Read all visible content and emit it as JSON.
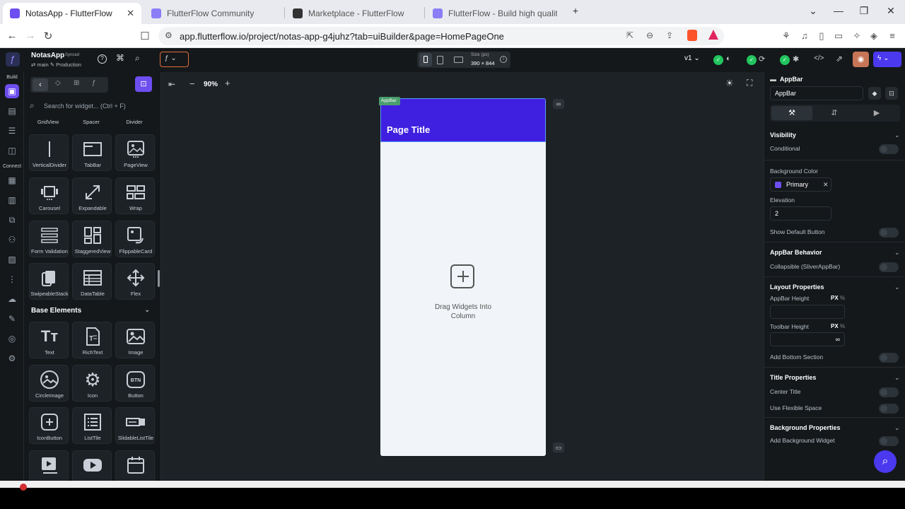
{
  "browser": {
    "tabs": [
      {
        "title": "NotasApp - FlutterFlow",
        "active": true
      },
      {
        "title": "FlutterFlow Community",
        "active": false
      },
      {
        "title": "Marketplace - FlutterFlow",
        "active": false
      },
      {
        "title": "FlutterFlow - Build high quality, cus",
        "active": false
      }
    ],
    "url": "app.flutterflow.io/project/notas-app-g4juhz?tab=uiBuilder&page=HomePageOne"
  },
  "topbar": {
    "project_name": "NotasApp",
    "sync_status": "Synced",
    "branch": "main",
    "environment": "Production",
    "device_size_label": "Size (px)",
    "device_size": "390 × 844",
    "version": "v1"
  },
  "rail": {
    "section_build": "Build",
    "section_connect": "Connect"
  },
  "widget_panel": {
    "search_placeholder": "Search for widget... (Ctrl + F)",
    "top_row": [
      "GridView",
      "Spacer",
      "Divider"
    ],
    "layout_items": [
      "VerticalDivider",
      "TabBar",
      "PageView",
      "Carousel",
      "Expandable",
      "Wrap",
      "Form Validation",
      "StaggeredView",
      "FlippableCard",
      "SwipeableStack",
      "DataTable",
      "Flex"
    ],
    "base_header": "Base Elements",
    "base_items": [
      "Text",
      "RichText",
      "Image",
      "CircleImage",
      "Icon",
      "Button",
      "IconButton",
      "ListTile",
      "SlidableListTile"
    ]
  },
  "canvas": {
    "zoom": "90%",
    "appbar_tag": "AppBar",
    "page_title": "Page Title",
    "drop_hint_line1": "Drag Widgets Into",
    "drop_hint_line2": "Column"
  },
  "properties": {
    "header": "AppBar",
    "name_value": "AppBar",
    "visibility": "Visibility",
    "conditional": "Conditional",
    "bg_color_label": "Background Color",
    "bg_color_value": "Primary",
    "elevation_label": "Elevation",
    "elevation_value": "2",
    "show_default_button": "Show Default Button",
    "appbar_behavior": "AppBar Behavior",
    "collapsible": "Collapsible (SliverAppBar)",
    "layout_properties": "Layout Properties",
    "appbar_height": "AppBar Height",
    "toolbar_height": "Toolbar Height",
    "px_label": "PX",
    "pct_label": "%",
    "toolbar_height_value": "∞",
    "add_bottom_section": "Add Bottom Section",
    "title_properties": "Title Properties",
    "center_title": "Center Title",
    "use_flexible_space": "Use Flexible Space",
    "background_properties": "Background Properties",
    "add_background_widget": "Add Background Widget"
  },
  "colors": {
    "accent": "#6d4ef0",
    "primary": "#3f1fe0",
    "green": "#22c55e",
    "bg": "#14181b"
  }
}
